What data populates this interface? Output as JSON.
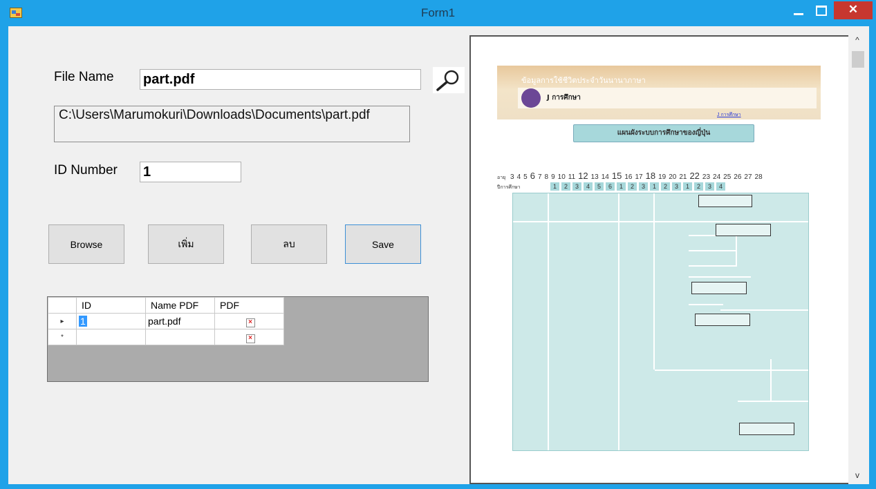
{
  "window": {
    "title": "Form1",
    "close_glyph": "✕",
    "scroll_up_glyph": "^",
    "scroll_down_glyph": "v"
  },
  "form": {
    "file_name_label": "File Name",
    "file_name_value": "part.pdf",
    "file_path": "C:\\Users\\Marumokuri\\Downloads\\Documents\\part.pdf",
    "id_number_label": "ID Number",
    "id_number_value": "1"
  },
  "buttons": {
    "browse": "Browse",
    "add": "เพิ่ม",
    "delete": "ลบ",
    "save": "Save"
  },
  "grid": {
    "columns": [
      "ID",
      "Name PDF",
      "PDF"
    ],
    "rows": [
      {
        "indicator": "▸",
        "id": "1",
        "name": "part.pdf",
        "pdf": "×"
      },
      {
        "indicator": "*",
        "id": "",
        "name": "",
        "pdf": "×"
      }
    ]
  },
  "pdf_preview": {
    "banner_top": "ข้อมูลการใช้ชีวิตประจำวันนานาภาษา",
    "banner_title": "J การศึกษา",
    "banner_link": "J การศึกษา",
    "section_title": "แผนผังระบบการศึกษาของญี่ปุ่น",
    "ages_label": "อายุ",
    "ages": [
      "3",
      "4",
      "5",
      "6",
      "7",
      "8",
      "9",
      "10",
      "11",
      "12",
      "13",
      "14",
      "15",
      "16",
      "17",
      "18",
      "19",
      "20",
      "21",
      "22",
      "23",
      "24",
      "25",
      "26",
      "27",
      "28"
    ],
    "grades_label": "ปีการศึกษา",
    "grades": [
      "1",
      "2",
      "3",
      "4",
      "5",
      "6",
      "1",
      "2",
      "3",
      "1",
      "2",
      "3",
      "1",
      "2",
      "3",
      "4"
    ]
  },
  "colors": {
    "titlebar": "#1fa2e8",
    "close_button": "#c7372f",
    "selection": "#3399ff",
    "focus_border": "#3c8fd6"
  },
  "icons": {
    "search": "search-icon",
    "app": "app-icon"
  }
}
